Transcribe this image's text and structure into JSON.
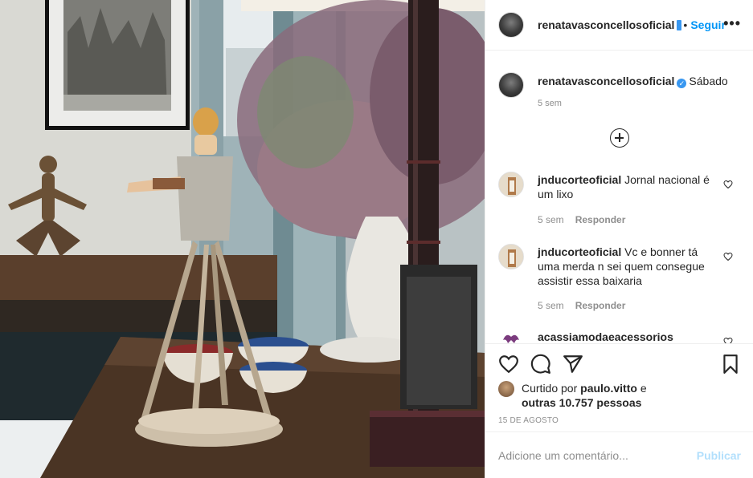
{
  "post": {
    "username": "renatavasconcellosoficial",
    "header_separator": "•",
    "follow_label": "Seguir",
    "more_label": "•••"
  },
  "caption": {
    "username": "renatavasconcellosoficial",
    "text": "Sábado",
    "time": "5 sem"
  },
  "comments": [
    {
      "username": "jnducorteoficial",
      "text": "Jornal nacional é um lixo",
      "time": "5 sem",
      "reply_label": "Responder"
    },
    {
      "username": "jnducorteoficial",
      "text": "Vc e bonner tá uma merda n sei quem consegue assistir essa baixaria",
      "time": "5 sem",
      "reply_label": "Responder"
    },
    {
      "username": "acassiamodaeacessorios",
      "text": ""
    }
  ],
  "likes": {
    "prefix": "Curtido por",
    "user": "paulo.vitto",
    "connector": "e",
    "others": "outras 10.757 pessoas"
  },
  "date": "15 DE AGOSTO",
  "add_comment": {
    "placeholder": "Adicione um comentário...",
    "publish_label": "Publicar"
  },
  "icons": {
    "like": "heart-icon",
    "comment": "comment-icon",
    "share": "share-icon",
    "save": "bookmark-icon",
    "load_more": "plus-circle-icon",
    "verified": "verified-badge-icon"
  },
  "colors": {
    "link_blue": "#0095f6",
    "publish_disabled": "#b2dffc",
    "muted_text": "#8e8e8e",
    "verified_blue": "#3897f0"
  }
}
